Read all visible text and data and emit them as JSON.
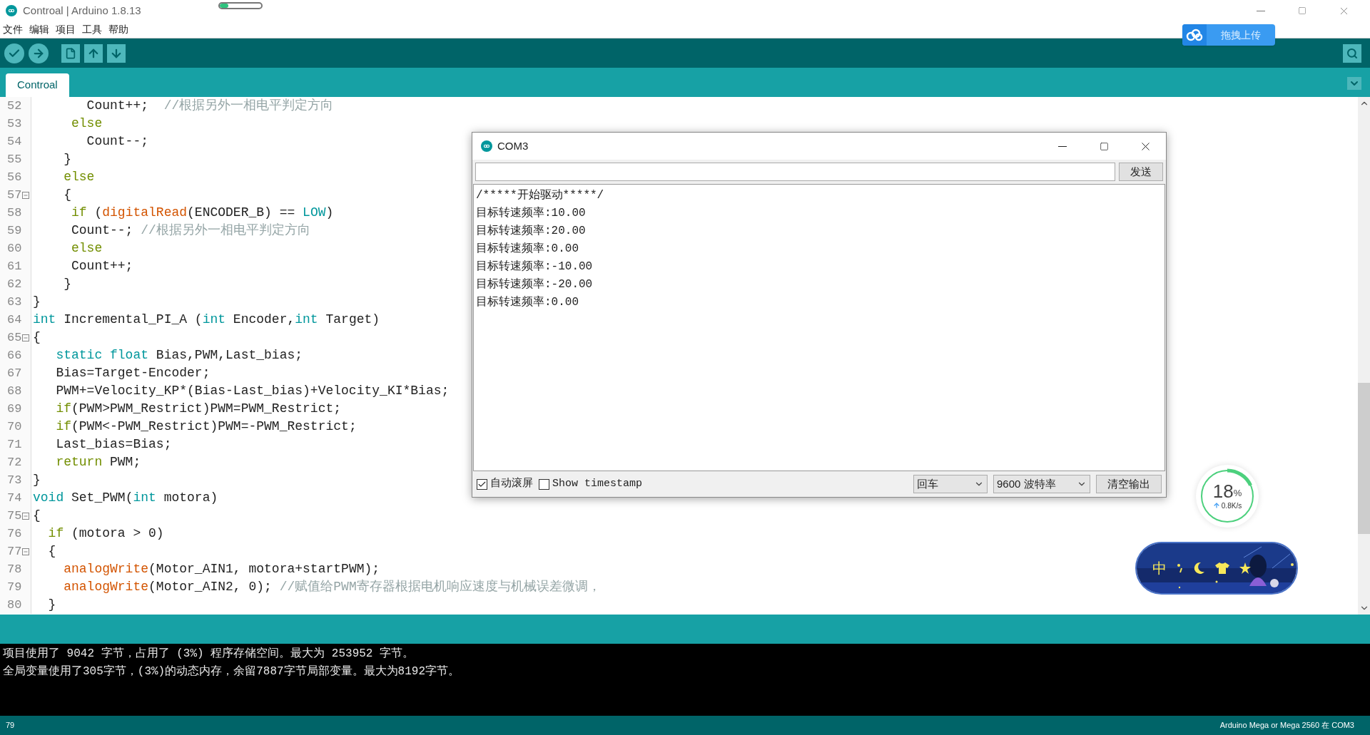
{
  "window": {
    "title": "Controal | Arduino 1.8.13"
  },
  "title_progress": {
    "level": 0.2
  },
  "menu": [
    "文件",
    "编辑",
    "项目",
    "工具",
    "帮助"
  ],
  "upload_button": {
    "label": "拖拽上传"
  },
  "tabs": [
    {
      "label": "Controal",
      "selected": true
    }
  ],
  "editor": {
    "lines": [
      {
        "number": "52",
        "foldable": false,
        "tokens": [
          {
            "kind": "plain",
            "text": "       Count++;  "
          },
          {
            "kind": "comment",
            "text": "//根据另外一相电平判定方向"
          }
        ]
      },
      {
        "number": "53",
        "foldable": false,
        "tokens": [
          {
            "kind": "keyword",
            "text": "     else"
          }
        ]
      },
      {
        "number": "54",
        "foldable": false,
        "tokens": [
          {
            "kind": "plain",
            "text": "       Count--;"
          }
        ]
      },
      {
        "number": "55",
        "foldable": false,
        "tokens": [
          {
            "kind": "plain",
            "text": "    }"
          }
        ]
      },
      {
        "number": "56",
        "foldable": false,
        "tokens": [
          {
            "kind": "keyword",
            "text": "    else"
          }
        ]
      },
      {
        "number": "57",
        "foldable": true,
        "tokens": [
          {
            "kind": "plain",
            "text": "    {"
          }
        ]
      },
      {
        "number": "58",
        "foldable": false,
        "tokens": [
          {
            "kind": "keyword",
            "text": "     if"
          },
          {
            "kind": "plain",
            "text": " ("
          },
          {
            "kind": "function",
            "text": "digitalRead"
          },
          {
            "kind": "plain",
            "text": "(ENCODER_B) == "
          },
          {
            "kind": "type",
            "text": "LOW"
          },
          {
            "kind": "plain",
            "text": ")"
          }
        ]
      },
      {
        "number": "59",
        "foldable": false,
        "tokens": [
          {
            "kind": "plain",
            "text": "     Count--; "
          },
          {
            "kind": "comment",
            "text": "//根据另外一相电平判定方向"
          }
        ]
      },
      {
        "number": "60",
        "foldable": false,
        "tokens": [
          {
            "kind": "keyword",
            "text": "     else"
          }
        ]
      },
      {
        "number": "61",
        "foldable": false,
        "tokens": [
          {
            "kind": "plain",
            "text": "     Count++;"
          }
        ]
      },
      {
        "number": "62",
        "foldable": false,
        "tokens": [
          {
            "kind": "plain",
            "text": "    }"
          }
        ]
      },
      {
        "number": "63",
        "foldable": false,
        "tokens": [
          {
            "kind": "plain",
            "text": "}"
          }
        ]
      },
      {
        "number": "64",
        "foldable": false,
        "tokens": [
          {
            "kind": "type",
            "text": "int"
          },
          {
            "kind": "plain",
            "text": " Incremental_PI_A ("
          },
          {
            "kind": "type",
            "text": "int"
          },
          {
            "kind": "plain",
            "text": " Encoder,"
          },
          {
            "kind": "type",
            "text": "int"
          },
          {
            "kind": "plain",
            "text": " Target)"
          }
        ]
      },
      {
        "number": "65",
        "foldable": true,
        "tokens": [
          {
            "kind": "plain",
            "text": "{"
          }
        ]
      },
      {
        "number": "66",
        "foldable": false,
        "tokens": [
          {
            "kind": "type",
            "text": "   static float"
          },
          {
            "kind": "plain",
            "text": " Bias,PWM,Last_bias;"
          }
        ]
      },
      {
        "number": "67",
        "foldable": false,
        "tokens": [
          {
            "kind": "plain",
            "text": "   Bias=Target-Encoder;"
          }
        ]
      },
      {
        "number": "68",
        "foldable": false,
        "tokens": [
          {
            "kind": "plain",
            "text": "   PWM+=Velocity_KP*(Bias-Last_bias)+Velocity_KI*Bias;"
          }
        ]
      },
      {
        "number": "69",
        "foldable": false,
        "tokens": [
          {
            "kind": "keyword",
            "text": "   if"
          },
          {
            "kind": "plain",
            "text": "(PWM>PWM_Restrict)PWM=PWM_Restrict;"
          }
        ]
      },
      {
        "number": "70",
        "foldable": false,
        "tokens": [
          {
            "kind": "keyword",
            "text": "   if"
          },
          {
            "kind": "plain",
            "text": "(PWM<-PWM_Restrict)PWM=-PWM_Restrict;"
          }
        ]
      },
      {
        "number": "71",
        "foldable": false,
        "tokens": [
          {
            "kind": "plain",
            "text": "   Last_bias=Bias;"
          }
        ]
      },
      {
        "number": "72",
        "foldable": false,
        "tokens": [
          {
            "kind": "keyword",
            "text": "   return"
          },
          {
            "kind": "plain",
            "text": " PWM;"
          }
        ]
      },
      {
        "number": "73",
        "foldable": false,
        "tokens": [
          {
            "kind": "plain",
            "text": "}"
          }
        ]
      },
      {
        "number": "74",
        "foldable": false,
        "tokens": [
          {
            "kind": "type",
            "text": "void"
          },
          {
            "kind": "plain",
            "text": " Set_PWM("
          },
          {
            "kind": "type",
            "text": "int"
          },
          {
            "kind": "plain",
            "text": " motora)"
          }
        ]
      },
      {
        "number": "75",
        "foldable": true,
        "tokens": [
          {
            "kind": "plain",
            "text": "{"
          }
        ]
      },
      {
        "number": "76",
        "foldable": false,
        "tokens": [
          {
            "kind": "keyword",
            "text": "  if"
          },
          {
            "kind": "plain",
            "text": " (motora > 0)"
          }
        ]
      },
      {
        "number": "77",
        "foldable": true,
        "tokens": [
          {
            "kind": "plain",
            "text": "  {"
          }
        ]
      },
      {
        "number": "78",
        "foldable": false,
        "tokens": [
          {
            "kind": "function",
            "text": "    analogWrite"
          },
          {
            "kind": "plain",
            "text": "(Motor_AIN1, motora+startPWM);"
          }
        ]
      },
      {
        "number": "79",
        "foldable": false,
        "tokens": [
          {
            "kind": "function",
            "text": "    analogWrite"
          },
          {
            "kind": "plain",
            "text": "(Motor_AIN2, 0); "
          },
          {
            "kind": "comment",
            "text": "//赋值给PWM寄存器根据电机响应速度与机械误差微调，"
          }
        ]
      },
      {
        "number": "80",
        "foldable": false,
        "tokens": [
          {
            "kind": "plain",
            "text": "  }"
          }
        ]
      }
    ]
  },
  "console": {
    "lines": [
      "项目使用了 9042 字节，占用了 (3%) 程序存储空间。最大为 253952 字节。",
      "全局变量使用了305字节，(3%)的动态内存，余留7887字节局部变量。最大为8192字节。"
    ]
  },
  "status_bar": {
    "line": "79",
    "board": "Arduino Mega or Mega 2560 在 COM3"
  },
  "serial_monitor": {
    "title": "COM3",
    "send_button": "发送",
    "output": [
      "/*****开始驱动*****/",
      "目标转速频率:10.00",
      "目标转速频率:20.00",
      "目标转速频率:0.00",
      "目标转速频率:-10.00",
      "目标转速频率:-20.00",
      "目标转速频率:0.00"
    ],
    "autoscroll": {
      "label": "自动滚屏",
      "checked": true
    },
    "timestamp": {
      "label": "Show timestamp",
      "checked": false
    },
    "line_ending": "回车",
    "baud_rate": "9600 波特率",
    "clear_button": "清空输出"
  },
  "network_meter": {
    "percent": "18",
    "unit": "%",
    "speed": "0.8K/s",
    "level": 0.18
  },
  "ime_toolbar": {
    "mode": "中"
  }
}
